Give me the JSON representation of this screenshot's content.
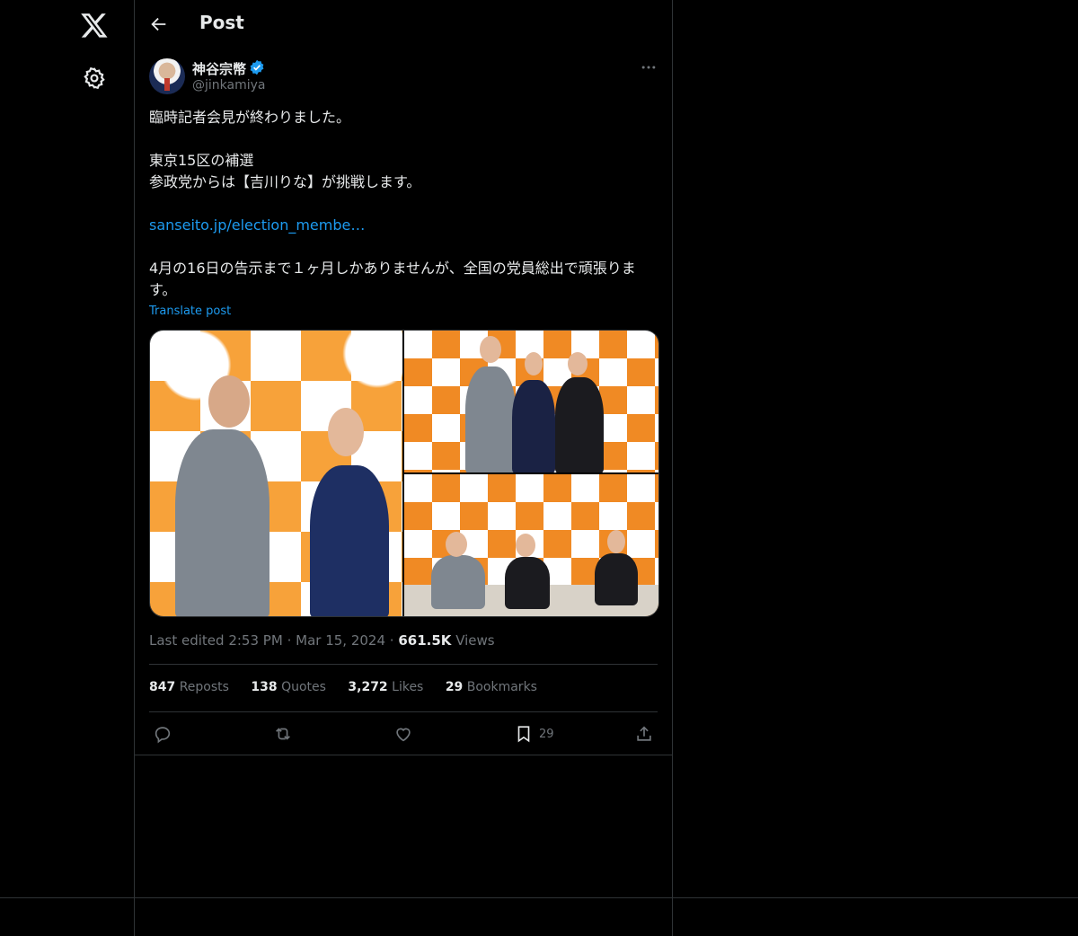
{
  "header": {
    "title": "Post"
  },
  "author": {
    "name": "神谷宗幣",
    "handle": "@jinkamiya"
  },
  "tweet": {
    "line1": "臨時記者会見が終わりました。",
    "line2": "東京15区の補選",
    "line3": "参政党からは【吉川りな】が挑戦します。",
    "link": "sanseito.jp/election_membe…",
    "line4": "4月の16日の告示まで１ヶ月しかありませんが、全国の党員総出で頑張ります。",
    "translate": "Translate post"
  },
  "meta": {
    "edited": "Last edited 2:53 PM",
    "sep1": "·",
    "date": "Mar 15, 2024",
    "sep2": "·",
    "views_count": "661.5K",
    "views_label": "Views"
  },
  "stats": [
    {
      "count": "847",
      "label": "Reposts"
    },
    {
      "count": "138",
      "label": "Quotes"
    },
    {
      "count": "3,272",
      "label": "Likes"
    },
    {
      "count": "29",
      "label": "Bookmarks"
    }
  ],
  "actions": {
    "bookmark_count": "29"
  },
  "colors": {
    "accent": "#1d9bf0",
    "border": "#2f3336",
    "muted": "#71767b",
    "background": "#000000"
  },
  "icons": [
    "x-logo-icon",
    "gear-icon",
    "back-arrow-icon",
    "verified-badge-icon",
    "more-icon",
    "reply-icon",
    "repost-icon",
    "like-icon",
    "bookmark-icon",
    "share-icon"
  ]
}
